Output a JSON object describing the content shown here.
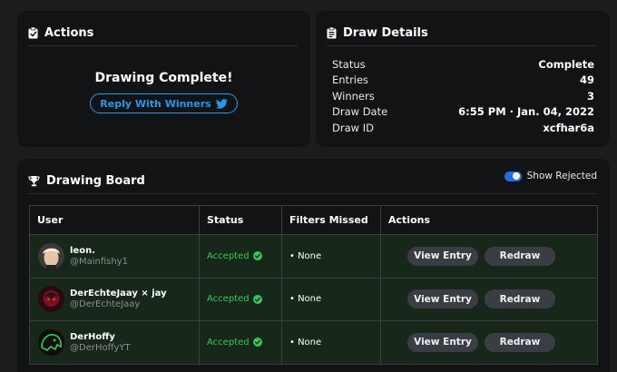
{
  "actions_card": {
    "title": "Actions",
    "complete_text": "Drawing Complete!",
    "reply_button_label": "Reply With Winners"
  },
  "details_card": {
    "title": "Draw Details",
    "rows": [
      {
        "label": "Status",
        "value": "Complete"
      },
      {
        "label": "Entries",
        "value": "49"
      },
      {
        "label": "Winners",
        "value": "3"
      },
      {
        "label": "Draw Date",
        "value": "6:55 PM · Jan. 04, 2022"
      },
      {
        "label": "Draw ID",
        "value": "xcfhar6a"
      }
    ]
  },
  "board": {
    "title": "Drawing Board",
    "toggle_label": "Show Rejected",
    "toggle_on": true,
    "columns": [
      "User",
      "Status",
      "Filters Missed",
      "Actions"
    ],
    "rows": [
      {
        "name": "leon.",
        "handle": "@Mainfishy1",
        "status": "Accepted",
        "filters": "• None",
        "view_label": "View Entry",
        "redraw_label": "Redraw",
        "avatar": "light-hair-avatar"
      },
      {
        "name": "DerEchteJaay × jay",
        "handle": "@DerEchteJaay",
        "status": "Accepted",
        "filters": "• None",
        "view_label": "View Entry",
        "redraw_label": "Redraw",
        "avatar": "red-dark-avatar"
      },
      {
        "name": "DerHoffy",
        "handle": "@DerHoffyYT",
        "status": "Accepted",
        "filters": "• None",
        "view_label": "View Entry",
        "redraw_label": "Redraw",
        "avatar": "green-panther-avatar"
      }
    ]
  },
  "colors": {
    "background": "#1b1c1e",
    "card": "#121314",
    "accent_blue": "#1d9bf0",
    "accepted_green": "#34c759",
    "row_green": "#17281a",
    "button_gray": "#3a3d43"
  }
}
